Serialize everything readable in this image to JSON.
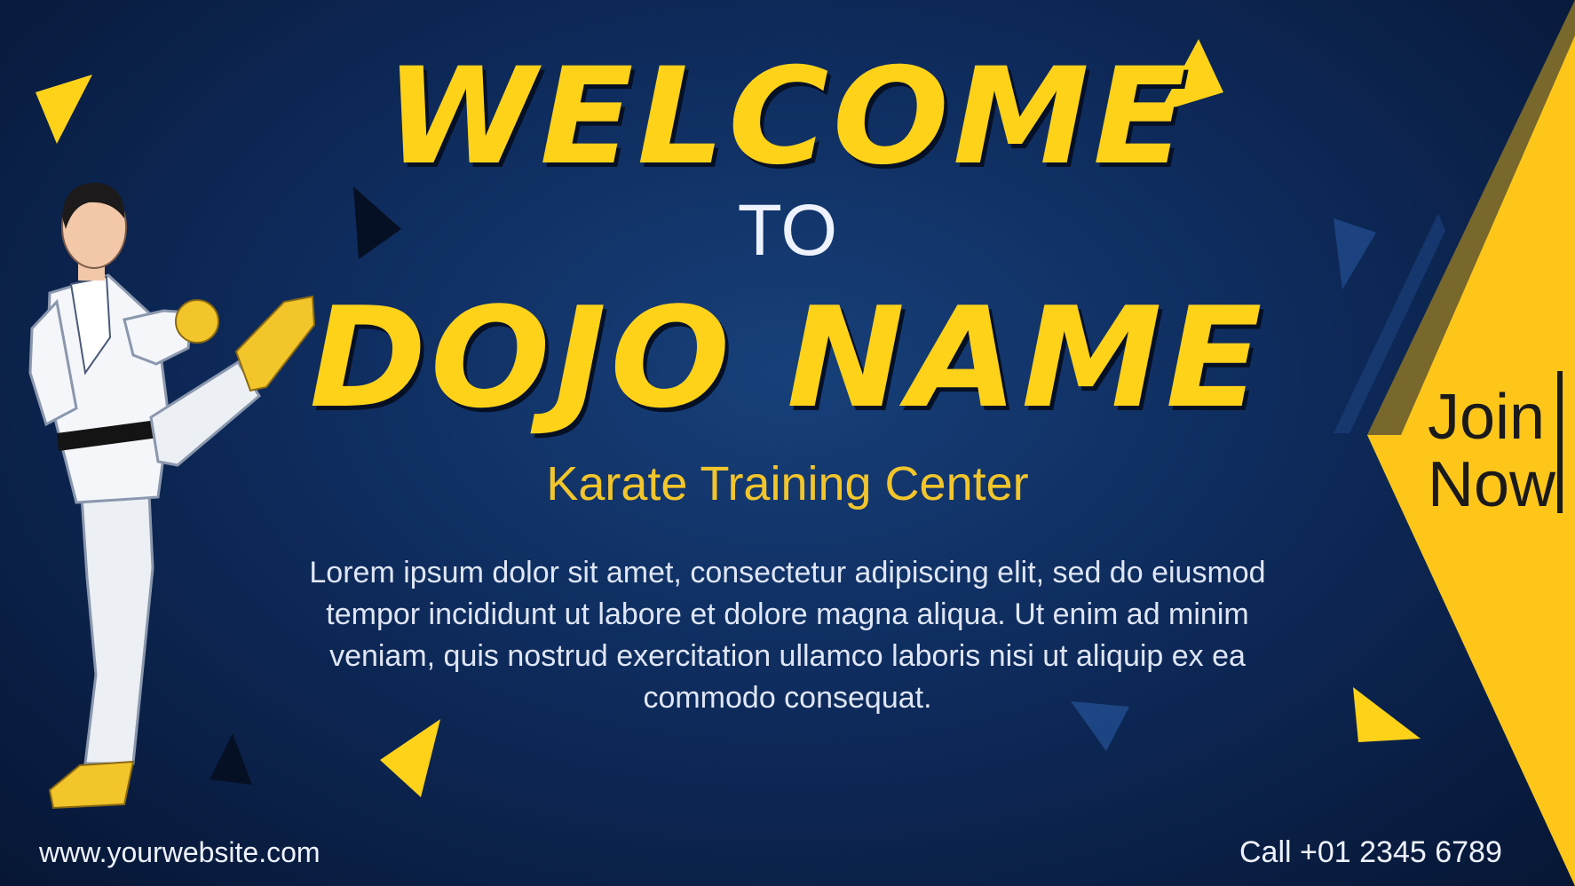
{
  "headline": {
    "welcome": "WELCOME",
    "to": "TO",
    "dojo": "DOJO NAME"
  },
  "subtitle": "Karate Training Center",
  "body_text": "Lorem ipsum dolor sit amet, consectetur adipiscing elit, sed do eiusmod tempor incididunt ut labore et dolore magna aliqua. Ut enim ad minim veniam, quis nostrud exercitation ullamco laboris nisi ut aliquip ex ea commodo consequat.",
  "cta": {
    "line1": "Join",
    "line2": "Now"
  },
  "footer": {
    "website": "www.yourwebsite.com",
    "phone": "Call +01 2345 6789"
  },
  "colors": {
    "background": "#0e2b5c",
    "accent_yellow": "#ffd21a",
    "subtitle_gold": "#f2c52b",
    "text_light": "#eef2ff"
  },
  "icons": {
    "karate": "karate-fighter-illustration",
    "decorations": "triangle-shapes"
  }
}
